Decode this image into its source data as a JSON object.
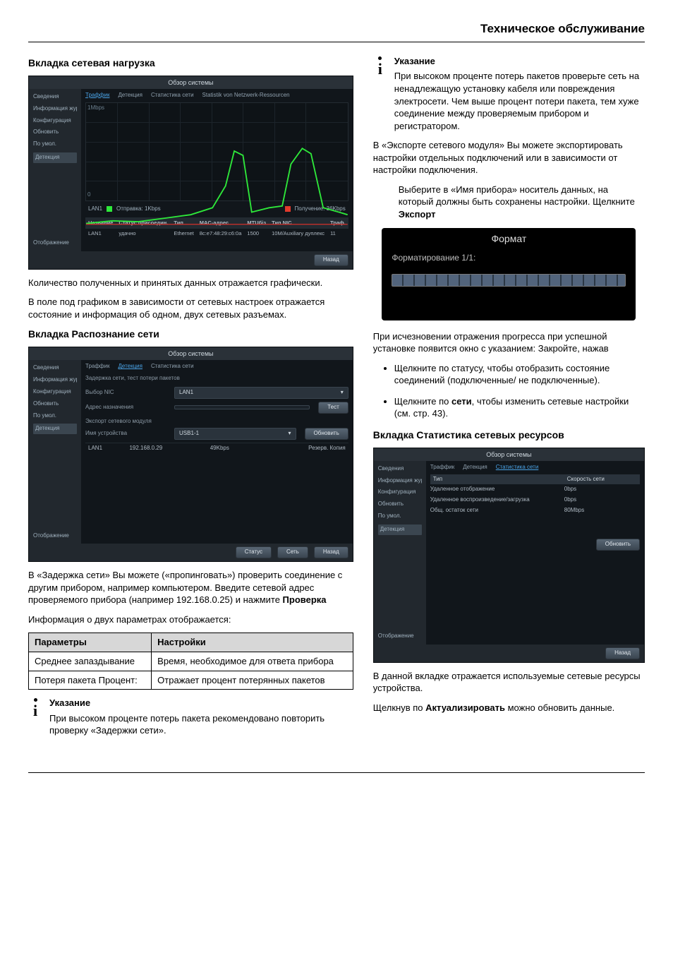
{
  "header_title": "Техническое обслуживание",
  "left": {
    "sec1_title": "Вкладка сетевая нагрузка",
    "sec1_p1": "Количество полученных и принятых данных отражается графически.",
    "sec1_p2": "В поле под графиком в зависимости от сетевых настроек отражается состояние и информация об одном, двух сетевых разъемах.",
    "sec2_title": "Вкладка Распознание сети",
    "sec2_p1a": "В «Задержка сети» Вы можете («пропинговать») проверить соединение с другим прибором, например компьютером. Введите сетевой адрес проверяемого прибора (например 192.168.0.25) и нажмите ",
    "sec2_p1b": "Проверка",
    "sec2_p2": "Информация о двух параметрах отображается:",
    "param_table": {
      "h1": "Параметры",
      "h2": "Настройки",
      "r1c1": "Среднее запаздывание",
      "r1c2": "Время, необходимое для ответа прибора",
      "r2c1": "Потеря пакета Процент:",
      "r2c2": "Отражает процент потерянных пакетов"
    },
    "note1_title": "Указание",
    "note1_body": "При высоком проценте потерь пакета рекомендовано повторить проверку «Задержки сети»."
  },
  "right": {
    "note2_title": "Указание",
    "note2_body": "При высоком проценте потерь пакетов проверьте сеть на ненадлежащую установку кабеля или повреждения электросети. Чем выше процент потери пакета, тем хуже соединение между проверяемым прибором и регистратором.",
    "export_p1": "В «Экспорте сетевого модуля» Вы можете экспортировать настройки отдельных подключений или  в зависимости от настройки  подключения.",
    "export_indent_a": "Выберите в «Имя прибора» носитель данных, на который должны быть сохранены настройки. Щелкните ",
    "export_indent_b": "Экспорт",
    "fmt_title": "Формат",
    "fmt_label": "Форматирование 1/1:",
    "after_fmt": "При исчезновении отражения прогресса при успешной установке появится окно с указанием: Закройте, нажав",
    "bullets": {
      "b1": "Щелкните по статусу, чтобы отобразить состояние соединений          (подключенные/ не подключенные).",
      "b2a": "Щелкните по ",
      "b2bold": "сети",
      "b2b": ", чтобы изменить сетевые настройки (см. стр. 43)."
    },
    "sec3_title": "Вкладка Статистика сетевых ресурсов",
    "final_p1": "В данной вкладке отражается используемые сетевые ресурсы устройства.",
    "final_p2a": "Щелкнув по ",
    "final_p2bold": "Актуализировать",
    "final_p2b": " можно обновить данные."
  },
  "shot_common": {
    "window_title": "Обзор системы",
    "sidebar": [
      "Сведения",
      "Информация журнала",
      "Конфигурация",
      "Обновить",
      "По умол.",
      "Детекция"
    ],
    "sidebar_footer": "Отображение",
    "back_btn": "Назад"
  },
  "shot1": {
    "tabs": [
      "Траффик",
      "Детекция",
      "Статистика сети",
      "Statistik von Netzwerk-Ressourcen"
    ],
    "ylabel": "1Mbps",
    "zero": "0",
    "legend_name": "LAN1",
    "legend_send": "Отправка: 1Kbps",
    "legend_recv": "Получение: 36Kbps",
    "table": {
      "headers": [
        "Название",
        "Статус присоедин.",
        "Тип",
        "MAC-адрес",
        "MTUбіз",
        "Тип NIC",
        "Траф."
      ],
      "row": [
        "LAN1",
        "удачно",
        "Ethernet",
        "8c:e7:48:29:c6:0a",
        "1500",
        "10M/Auxiliary дуплекс",
        "11"
      ]
    }
  },
  "shot2": {
    "tabs": [
      "Траффик",
      "Детекция",
      "Статистика сети"
    ],
    "sub": "Задержка сети, тест потери пакетов",
    "nic_label": "Выбор NIC",
    "nic_value": "LAN1",
    "addr_label": "Адрес назначения",
    "test_btn": "Тест",
    "export_label": "Экспорт сетевого модуля",
    "dev_label": "Имя устройства",
    "dev_value": "USB1-1",
    "refresh_btn": "Обновить",
    "tbl_row": [
      "LAN1",
      "192.168.0.29",
      "49Kbps",
      "Резерв. Копия"
    ],
    "status_btn": "Статус",
    "net_btn": "Сеть"
  },
  "shot3": {
    "tabs": [
      "Траффик",
      "Детекция",
      "Статистика сети"
    ],
    "col1": "Тип",
    "col2": "Скорость сети",
    "rows": [
      [
        "Удаленное отображение",
        "0bps"
      ],
      [
        "Удаленное воспроизведение/загрузка",
        "0bps"
      ],
      [
        "Общ. остаток сети",
        "80Mbps"
      ]
    ],
    "refresh_btn": "Обновить"
  }
}
